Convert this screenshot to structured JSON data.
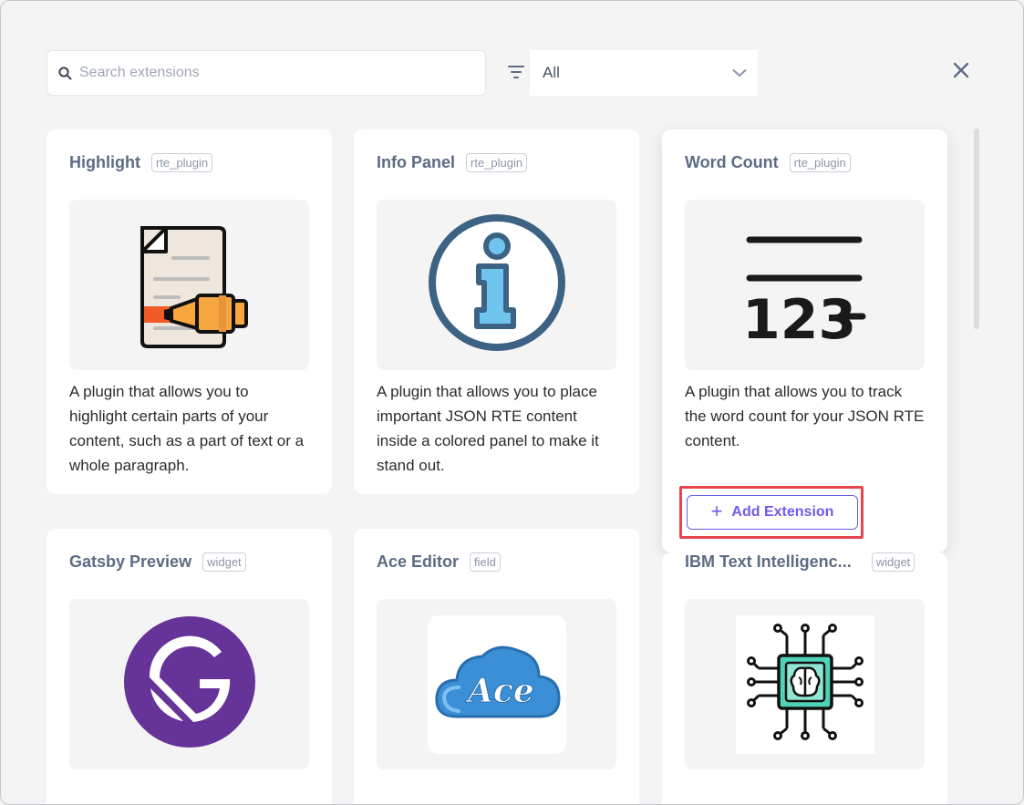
{
  "search": {
    "placeholder": "Search extensions",
    "value": ""
  },
  "filter": {
    "selected": "All"
  },
  "colors": {
    "accent": "#6c5ce7",
    "highlight_border": "#e6454d",
    "title": "#5d6b83"
  },
  "cards": [
    {
      "title": "Highlight",
      "badge": "rte_plugin",
      "icon": "highlighter-document-icon",
      "description": "A plugin that allows you to highlight certain parts of your content, such as a part of text or a whole paragraph."
    },
    {
      "title": "Info Panel",
      "badge": "rte_plugin",
      "icon": "info-circle-icon",
      "description": "A plugin that allows you to place important JSON RTE content inside a colored panel to make it stand out."
    },
    {
      "title": "Word Count",
      "badge": "rte_plugin",
      "icon": "word-count-123-icon",
      "description": "A plugin that allows you to track the word count for your JSON RTE content."
    },
    {
      "title": "Gatsby Preview",
      "badge": "widget",
      "icon": "gatsby-logo-icon",
      "description": ""
    },
    {
      "title": "Ace Editor",
      "badge": "field",
      "icon": "ace-cloud-logo-icon",
      "description": ""
    },
    {
      "title": "IBM Text Intelligenc...",
      "badge": "widget",
      "icon": "brain-chip-icon",
      "description": ""
    }
  ],
  "add_extension": {
    "label": "Add Extension"
  },
  "icons": {
    "search": "search-icon",
    "filter": "filter-icon",
    "chevron": "chevron-down-icon",
    "close": "close-icon",
    "plus": "plus-icon"
  }
}
